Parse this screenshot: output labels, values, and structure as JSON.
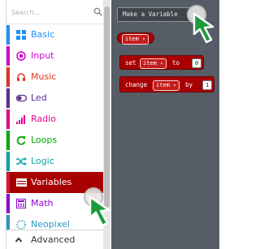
{
  "search": {
    "placeholder": "Search..."
  },
  "categories": [
    {
      "label": "Basic",
      "color": "#1e90ff",
      "icon": "grid-icon",
      "selected": false
    },
    {
      "label": "Input",
      "color": "#d400d4",
      "icon": "radio-target-icon",
      "selected": false
    },
    {
      "label": "Music",
      "color": "#e63022",
      "icon": "headphones-icon",
      "selected": false
    },
    {
      "label": "Led",
      "color": "#5c2d91",
      "icon": "toggle-icon",
      "selected": false
    },
    {
      "label": "Radio",
      "color": "#e3008c",
      "icon": "signal-bars-icon",
      "selected": false
    },
    {
      "label": "Loops",
      "color": "#00aa00",
      "icon": "refresh-icon",
      "selected": false
    },
    {
      "label": "Logic",
      "color": "#00a4a6",
      "icon": "shuffle-icon",
      "selected": false
    },
    {
      "label": "Variables",
      "color": "#dc143c",
      "icon": "list-icon",
      "selected": true
    },
    {
      "label": "Math",
      "color": "#9400d3",
      "icon": "calculator-icon",
      "selected": false
    },
    {
      "label": "Neopixel",
      "color": "#2699bf",
      "icon": "dotted-circle-icon",
      "selected": false
    }
  ],
  "advanced": {
    "label": "Advanced"
  },
  "flyout": {
    "make_variable_label": "Make a Variable",
    "variable_block": {
      "name": "item"
    },
    "set_block": {
      "keyword": "set",
      "variable": "item",
      "to_label": "to",
      "value": "0"
    },
    "change_block": {
      "keyword": "change",
      "variable": "item",
      "by_label": "by",
      "value": "1"
    }
  },
  "colors": {
    "variables_block": "#a80000",
    "flyout_bg": "#565d66",
    "selected_category_bg": "#a80000"
  }
}
